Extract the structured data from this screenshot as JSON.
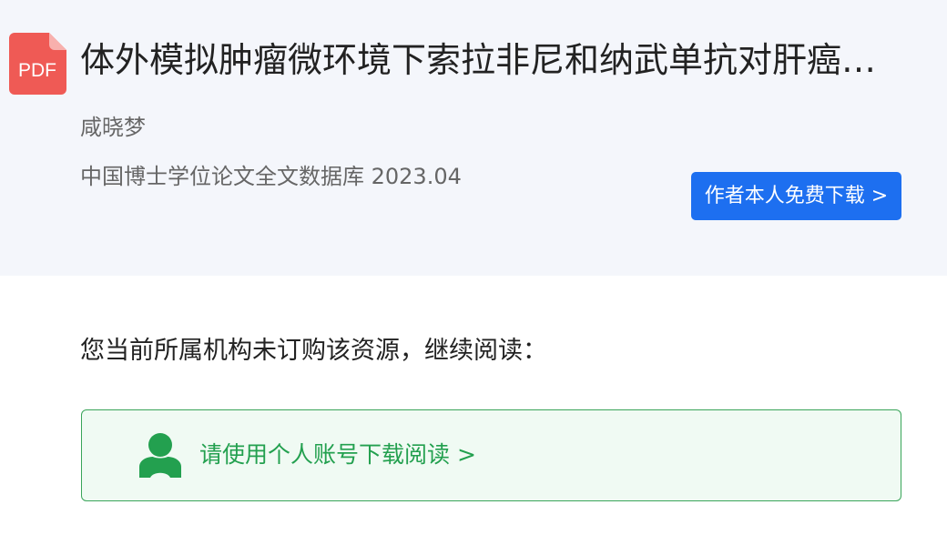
{
  "document": {
    "icon_label": "PDF",
    "title": "体外模拟肿瘤微环境下索拉非尼和纳武单抗对肝癌…",
    "author": "咸晓梦",
    "source": "中国博士学位论文全文数据库 2023.04"
  },
  "actions": {
    "author_free_download": "作者本人免费下载 >"
  },
  "access": {
    "notice": "您当前所属机构未订购该资源，继续阅读：",
    "personal_download": "请使用个人账号下载阅读 >"
  },
  "colors": {
    "pdf_icon": "#ef5a55",
    "primary_button": "#1d6ff0",
    "personal_green": "#23a04f",
    "header_bg": "#f4f6fb"
  }
}
